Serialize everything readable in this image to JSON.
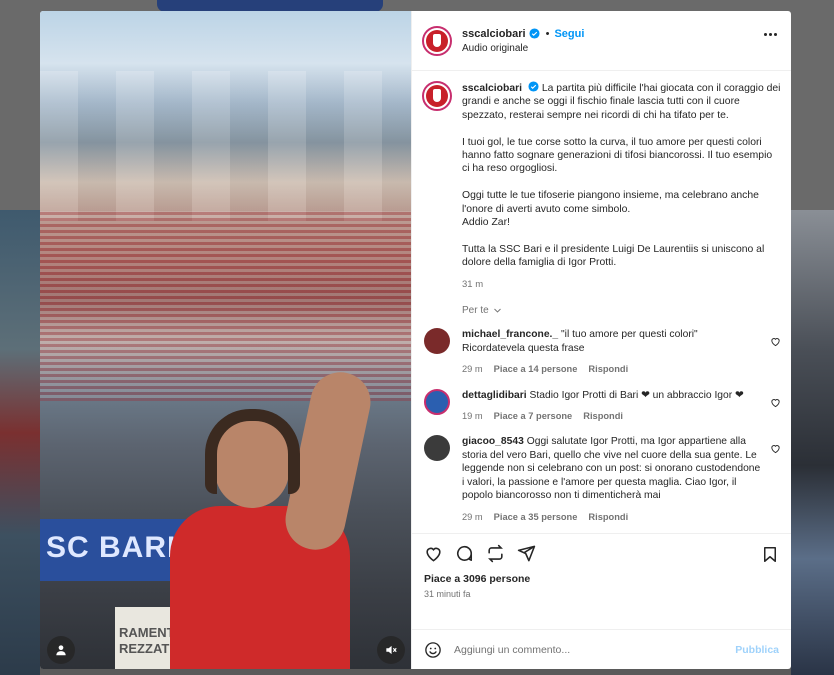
{
  "post": {
    "username": "sscalciobari",
    "follow_label": "Segui",
    "dot": "•",
    "audio": "Audio originale",
    "caption_paragraphs": [
      "La partita più difficile l'hai giocata con il coraggio dei grandi e anche se oggi il fischio finale lascia tutti con il cuore spezzato, resterai sempre nei ricordi di chi ha tifato per te.",
      "I tuoi gol, le tue corse sotto la curva, il tuo amore per questi colori hanno fatto sognare generazioni di tifosi biancorossi. Il tuo esempio ci ha reso orgogliosi.",
      "Oggi tutte le tue tifoserie piangono insieme, ma celebrano anche l'onore di averti avuto come simbolo.\nAddio Zar!",
      "Tutta la SSC Bari e il presidente Luigi De Laurentiis si uniscono al dolore della famiglia di Igor Protti."
    ],
    "caption_time": "31 m",
    "see_translation": "Per te",
    "likes": "Piace a 3096 persone",
    "time_ago": "31 minuti fa",
    "banner_text": "SC BARI",
    "sign_text": "RAMENT\nREZZAT"
  },
  "comments": [
    {
      "username": "michael_francone._",
      "text": "\"il tuo amore per questi colori\"\nRicordatevela questa frase",
      "time": "29 m",
      "likes": "Piace a 14 persone",
      "reply": "Rispondi",
      "avatar_color": "#7a2a2a"
    },
    {
      "username": "dettaglidibari",
      "text": "Stadio Igor Protti di Bari ❤ un abbraccio Igor ❤",
      "time": "19 m",
      "likes": "Piace a 7 persone",
      "reply": "Rispondi",
      "avatar_color": "#2b5fb0"
    },
    {
      "username": "giacoo_8543",
      "text": "Oggi salutate Igor Protti, ma Igor appartiene alla storia del vero Bari, quello che vive nel cuore della sua gente. Le leggende non si celebrano con un post: si onorano custodendone i valori, la passione e l'amore per questa maglia. Ciao Igor, il popolo biancorosso non ti dimenticherà mai",
      "time": "29 m",
      "likes": "Piace a 35 persone",
      "reply": "Rispondi",
      "avatar_color": "#3b3b3b"
    }
  ],
  "composer": {
    "placeholder": "Aggiungi un commento...",
    "publish_label": "Pubblica"
  },
  "icons": {
    "like": "heart-icon",
    "comment": "comment-icon",
    "share": "repost-icon",
    "send": "send-icon",
    "save": "bookmark-icon",
    "more": "more-icon",
    "emoji": "emoji-icon",
    "mute": "mute-icon",
    "tagged": "user-tag-icon"
  },
  "colors": {
    "accent": "#0095f6",
    "brand_red": "#c8202a",
    "heart": "#ed4956"
  }
}
